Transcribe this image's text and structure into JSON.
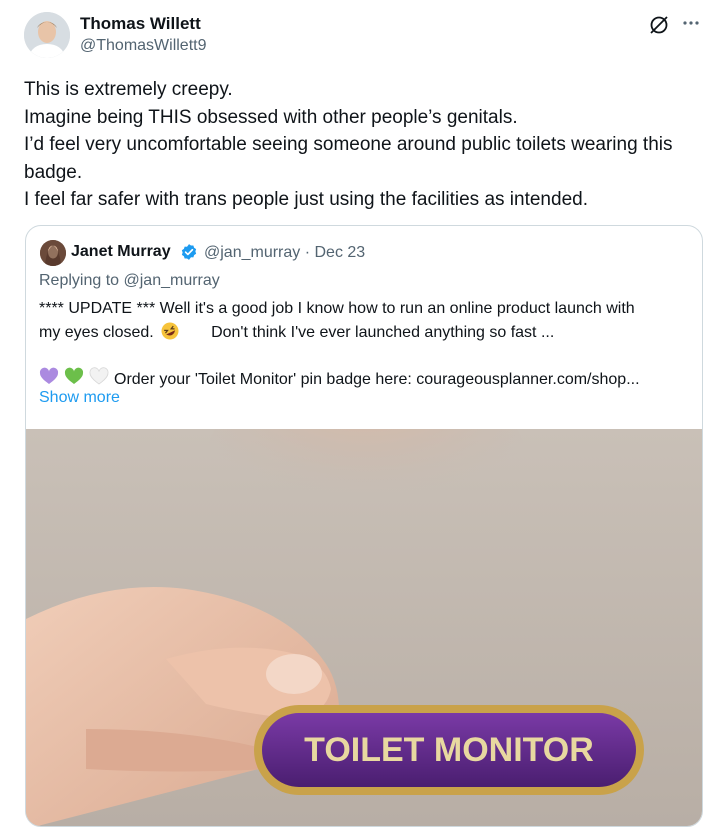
{
  "author": {
    "name": "Thomas Willett",
    "handle": "@ThomasWillett9"
  },
  "tweet": {
    "lines": [
      "This is extremely creepy.",
      "Imagine being THIS obsessed with other people’s genitals.",
      "I’d feel very uncomfortable seeing someone around public toilets wearing this",
      "badge.",
      "I feel far safer with trans people just using the facilities as intended."
    ]
  },
  "icons": {
    "grok": "grok-icon",
    "more": "more-icon",
    "verified": "verified-badge-icon",
    "rofl": "rolling-on-floor-laughing-emoji",
    "hearts": [
      "purple-heart-emoji",
      "green-heart-emoji",
      "white-heart-emoji"
    ]
  },
  "quote": {
    "name": "Janet Murray",
    "handle_date": "@jan_murray · Dec 23",
    "replying_to": "Replying to @jan_murray",
    "body_line1": "**** UPDATE ***  Well it's a good job I know how to run an online product launch with",
    "body_line2a": "my eyes closed.",
    "body_line2b": "Don't think I've ever launched anything so fast ...",
    "body_line3": "Order your 'Toilet Monitor' pin badge here: courageousplanner.com/shop...",
    "show_more": "Show more",
    "image_badge_text": "TOILET MONITOR"
  },
  "colors": {
    "text": "#0f1419",
    "muted": "#536471",
    "link": "#1d9bf0",
    "border": "#cfd9de",
    "badge_purple": "#5b2a86",
    "badge_gold": "#c9a24a"
  }
}
